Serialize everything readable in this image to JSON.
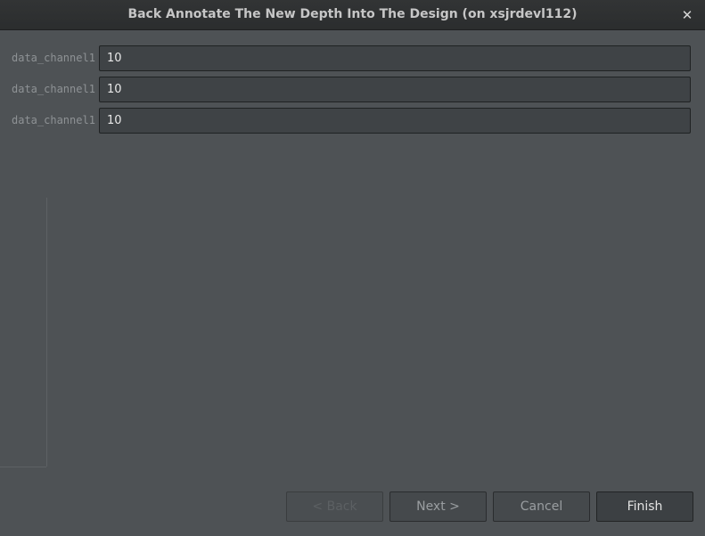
{
  "window": {
    "title": "Back Annotate The New Depth Into The Design  (on xsjrdevl112)",
    "close_glyph": "✕"
  },
  "fields": [
    {
      "label": "data_channel1",
      "value": "10"
    },
    {
      "label": "data_channel1",
      "value": "10"
    },
    {
      "label": "data_channel1",
      "value": "10"
    }
  ],
  "buttons": {
    "back": "< Back",
    "next": "Next >",
    "cancel": "Cancel",
    "finish": "Finish"
  }
}
